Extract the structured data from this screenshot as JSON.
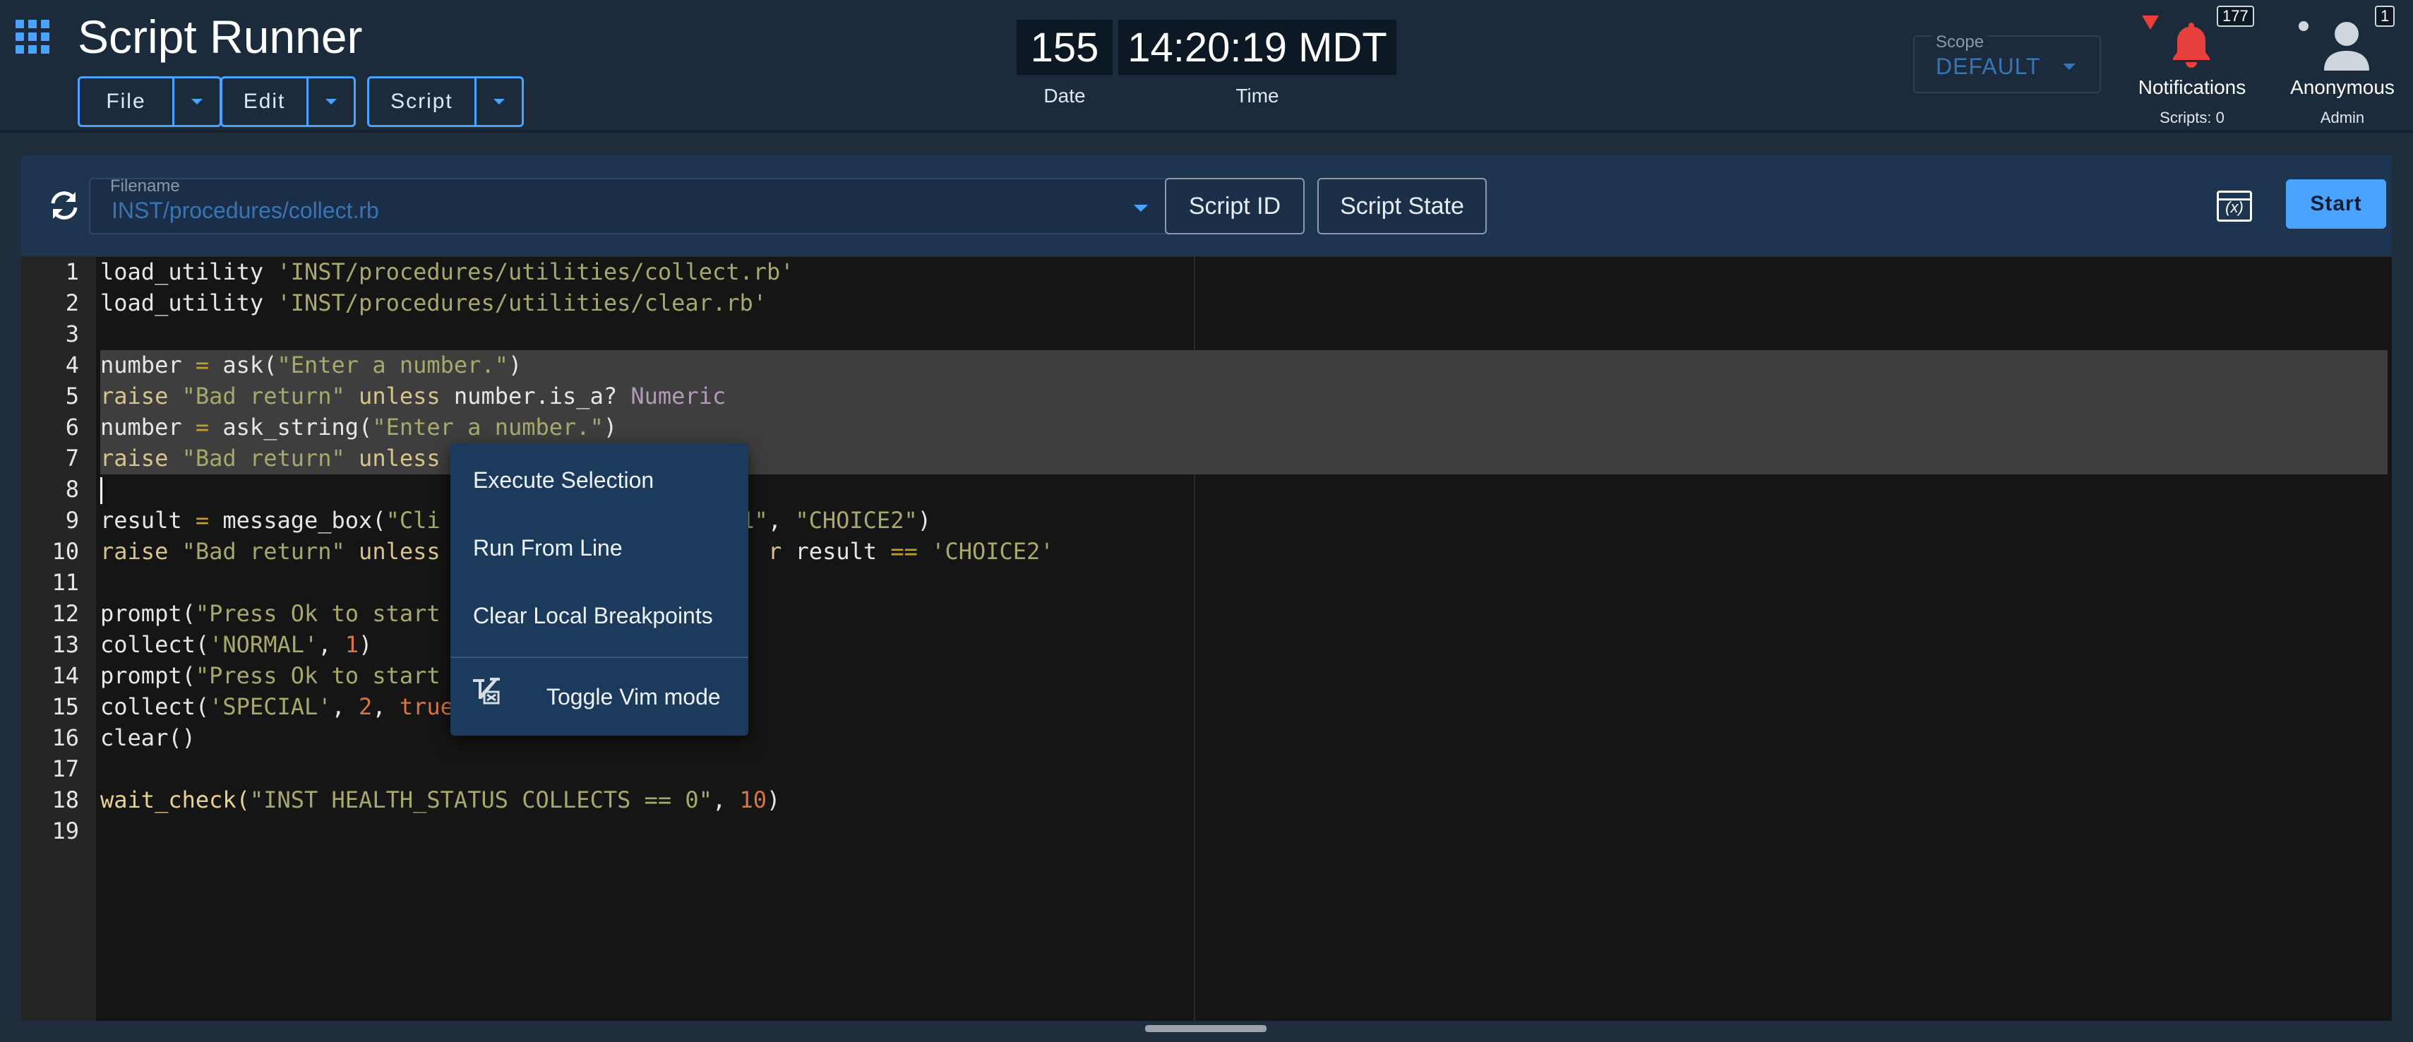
{
  "app": {
    "title": "Script Runner"
  },
  "menus": {
    "file": "File",
    "edit": "Edit",
    "script": "Script"
  },
  "clock": {
    "date_value": "155",
    "date_label": "Date",
    "time_value": "14:20:19 MDT",
    "time_label": "Time"
  },
  "scope": {
    "label": "Scope",
    "value": "DEFAULT"
  },
  "notifications": {
    "label": "Notifications",
    "count": "177",
    "scripts": "Scripts: 0",
    "alert_color": "#e8413d"
  },
  "user": {
    "name": "Anonymous",
    "role": "Admin",
    "count": "1"
  },
  "toolbar": {
    "filename_label": "Filename",
    "filename_value": "INST/procedures/collect.rb",
    "script_id": "Script ID",
    "script_state": "Script State",
    "start": "Start",
    "accent": "#4aa3ff"
  },
  "editor": {
    "line_numbers": [
      "1",
      "2",
      "3",
      "4",
      "5",
      "6",
      "7",
      "8",
      "9",
      "10",
      "11",
      "12",
      "13",
      "14",
      "15",
      "16",
      "17",
      "18",
      "19"
    ],
    "lines": {
      "l1": {
        "a": "load_utility ",
        "b": "'INST/procedures/utilities/collect.rb'"
      },
      "l2": {
        "a": "load_utility ",
        "b": "'INST/procedures/utilities/clear.rb'"
      },
      "l4": {
        "a": "number ",
        "b": "=",
        "c": " ask(",
        "d": "\"Enter a number.\"",
        "e": ")"
      },
      "l5": {
        "a": "raise",
        "b": " \"Bad return\" ",
        "c": "unless",
        "d": " number.is_a? ",
        "e": "Numeric"
      },
      "l6": {
        "a": "number ",
        "b": "=",
        "c": " ask_string(",
        "d": "\"Enter a number.\"",
        "e": ")"
      },
      "l7": {
        "a": "raise",
        "b": " \"Bad return\" ",
        "c": "unless"
      },
      "l9": {
        "a": "result ",
        "b": "=",
        "c": " message_box(",
        "d": "\"Cli",
        "e": "E1\"",
        "f": ", ",
        "g": "\"CHOICE2\"",
        "h": ")"
      },
      "l10": {
        "a": "raise",
        "b": " \"Bad return\" ",
        "c": "unless",
        "d": "r",
        "e": " result ",
        "f": "==",
        "g": " 'CHOICE2'"
      },
      "l12": {
        "a": "prompt(",
        "b": "\"Press Ok to start"
      },
      "l13": {
        "a": "collect(",
        "b": "'NORMAL'",
        "c": ", ",
        "d": "1",
        "e": ")"
      },
      "l14": {
        "a": "prompt(",
        "b": "\"Press Ok to start"
      },
      "l15": {
        "a": "collect(",
        "b": "'SPECIAL'",
        "c": ", ",
        "d": "2",
        "e": ", ",
        "f": "true"
      },
      "l16": {
        "a": "clear()"
      },
      "l18": {
        "a": "wait_check(",
        "b": "\"INST HEALTH_STATUS COLLECTS == 0\"",
        "c": ", ",
        "d": "10",
        "e": ")"
      }
    }
  },
  "context_menu": {
    "execute_selection": "Execute Selection",
    "run_from_line": "Run From Line",
    "clear_breakpoints": "Clear Local Breakpoints",
    "toggle_vim": "Toggle Vim mode"
  }
}
